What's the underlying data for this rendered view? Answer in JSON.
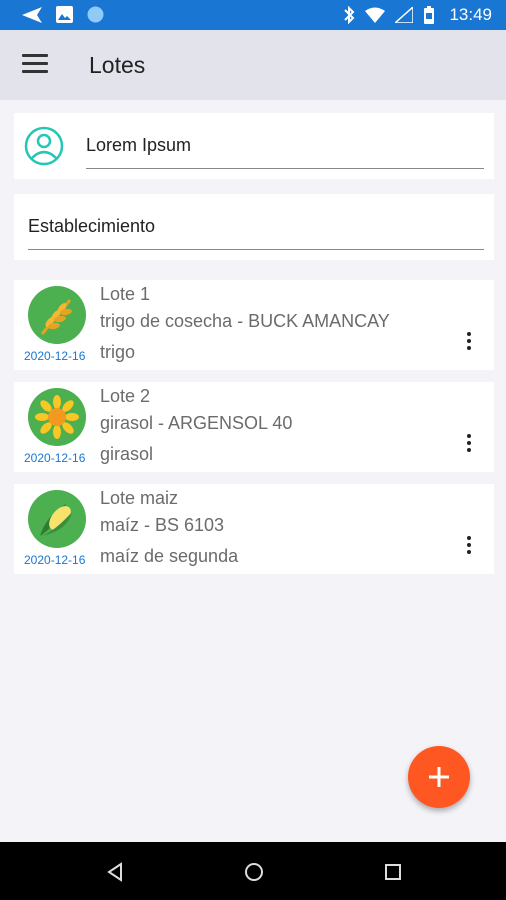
{
  "status_bar": {
    "time": "13:49",
    "left_icons": [
      "send-icon",
      "image-icon",
      "circle-icon"
    ],
    "right_icons": [
      "bluetooth-icon",
      "wifi-icon",
      "signal-icon",
      "battery-icon"
    ],
    "color": "#1976d2"
  },
  "app_bar": {
    "title": "Lotes",
    "menu_icon": "hamburger-menu-icon"
  },
  "user": {
    "name": "Lorem Ipsum",
    "icon": "account-circle-icon"
  },
  "establecimiento": {
    "label": "Establecimiento"
  },
  "lotes": [
    {
      "title": "Lote 1",
      "line2": "trigo de cosecha - BUCK AMANCAY",
      "line3": "trigo",
      "date": "2020-12-16",
      "icon": "wheat-icon"
    },
    {
      "title": "Lote 2",
      "line2": "girasol - ARGENSOL 40",
      "line3": "girasol",
      "date": "2020-12-16",
      "icon": "sunflower-icon"
    },
    {
      "title": "Lote maiz",
      "line2": "maíz - BS 6103",
      "line3": "maíz de segunda",
      "date": "2020-12-16",
      "icon": "corn-icon"
    }
  ],
  "fab": {
    "icon": "plus-icon",
    "color": "#ff5722"
  },
  "nav_bar": {
    "buttons": [
      "back-icon",
      "home-icon",
      "recents-icon"
    ]
  },
  "colors": {
    "accent": "#1976d2",
    "avatar_bg": "#4caf50",
    "user_icon": "#26c6b4"
  }
}
